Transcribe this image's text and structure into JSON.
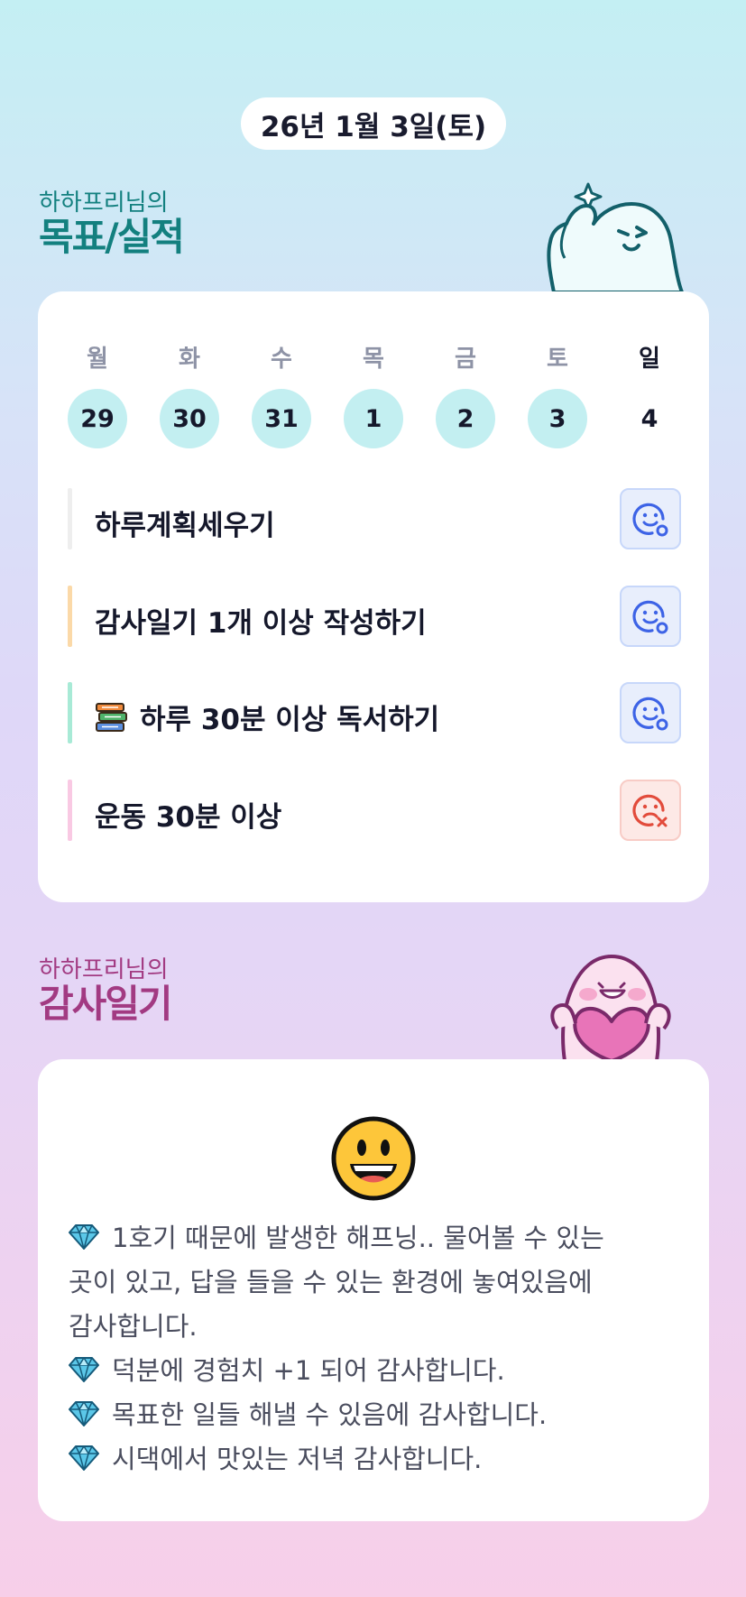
{
  "date": "26년 1월 3일(토)",
  "goals_section": {
    "subtitle": "하하프리님의",
    "title": "목표/실적"
  },
  "week": {
    "days": [
      {
        "name": "월",
        "num": "29",
        "highlight": true
      },
      {
        "name": "화",
        "num": "30",
        "highlight": true
      },
      {
        "name": "수",
        "num": "31",
        "highlight": true
      },
      {
        "name": "목",
        "num": "1",
        "highlight": true
      },
      {
        "name": "금",
        "num": "2",
        "highlight": true
      },
      {
        "name": "토",
        "num": "3",
        "highlight": true
      },
      {
        "name": "일",
        "num": "4",
        "highlight": false
      }
    ]
  },
  "goals": [
    {
      "label": "하루계획세우기",
      "bar_color": "#eeeeee",
      "status": "success"
    },
    {
      "label": "감사일기 1개 이상 작성하기",
      "bar_color": "#fbd9a8",
      "status": "success"
    },
    {
      "label": "하루 30분 이상 독서하기",
      "bar_color": "#a8ead6",
      "status": "success",
      "icon": "books-icon"
    },
    {
      "label": "운동 30분 이상",
      "bar_color": "#f9c9e3",
      "status": "fail"
    }
  ],
  "diary_section": {
    "subtitle": "하하프리님의",
    "title": "감사일기"
  },
  "diary": {
    "mood_icon": "grinning-face-icon",
    "bullet_icon": "gem-icon",
    "lines": [
      {
        "text": "1호기 때문에 발생한 해프닝.. 물어볼 수 있는",
        "bullet": true
      },
      {
        "text": "곳이 있고, 답을 들을 수 있는 환경에 놓여있음에",
        "bullet": false
      },
      {
        "text": "감사합니다.",
        "bullet": false
      },
      {
        "text": "덕분에 경험치 +1 되어 감사합니다.",
        "bullet": true
      },
      {
        "text": "목표한 일들 해낼 수 있음에 감사합니다.",
        "bullet": true
      },
      {
        "text": "시댁에서 맛있는 저녁 감사합니다.",
        "bullet": true
      }
    ]
  },
  "colors": {
    "goals_title": "#13807f",
    "diary_title": "#a23a82",
    "day_circle": "#c3eff1",
    "success_icon": "#3d63e6",
    "fail_icon": "#e24b3b"
  }
}
